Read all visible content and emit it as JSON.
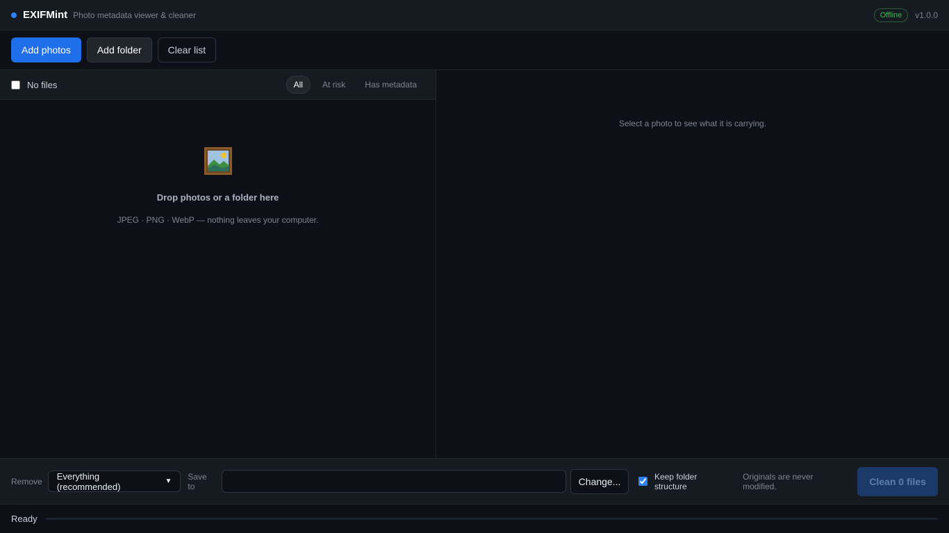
{
  "titlebar": {
    "app_name": "EXIFMint",
    "tagline": "Photo metadata viewer & cleaner",
    "connection_badge": "Offline",
    "version": "v1.0.0"
  },
  "toolbar": {
    "add_photos": "Add photos",
    "add_folder": "Add folder",
    "clear_list": "Clear list"
  },
  "file_list": {
    "select_all_label": "No files",
    "select_all_checked": false,
    "filters": [
      "All",
      "At risk",
      "Has metadata"
    ],
    "active_filter": "All",
    "empty_icon": "framed-picture-icon",
    "empty_title": "Drop photos or a folder here",
    "empty_subtitle": "JPEG · PNG · WebP — nothing leaves your computer."
  },
  "detail": {
    "hint": "Select a photo to see what it is carrying."
  },
  "actions": {
    "remove_label": "Remove",
    "remove_selected": "Everything (recommended)",
    "save_to_label": "Save to",
    "save_to_value": "",
    "change_button": "Change...",
    "keep_structure_label": "Keep folder structure",
    "keep_structure_checked": true,
    "note": "Originals are never modified.",
    "clean_button": "Clean 0 files"
  },
  "status": {
    "text": "Ready",
    "progress": 0
  },
  "colors": {
    "accent": "#2f81f7",
    "primary_button": "#1f6feb",
    "offline_green": "#3fb950",
    "background": "#0d1117",
    "panel": "#161b22"
  }
}
